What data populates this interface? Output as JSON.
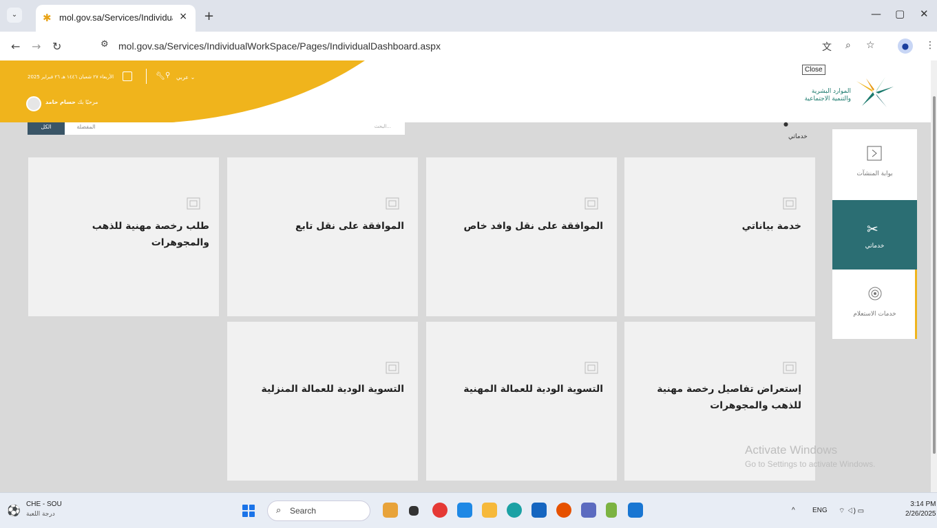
{
  "browser": {
    "tab_title": "mol.gov.sa/Services/IndividualW",
    "tab_close": "×",
    "new_tab": "+",
    "url": "mol.gov.sa/Services/IndividualWorkSpace/Pages/IndividualDashboard.aspx",
    "window_controls": {
      "minimize": "—",
      "maximize": "▢",
      "close": "✕"
    }
  },
  "header": {
    "date_text": "الأربعاء ٢٧ شعبان ١٤٤٦ هـ ٢٦ فبراير 2025",
    "language": "عربي ⌄",
    "welcome_prefix": "مرحبًا بك",
    "user_name": "حسام حامد",
    "logo_line1": "الموارد البشرية",
    "logo_line2": "والتنمية الاجتماعية",
    "close_tooltip": "Close"
  },
  "toolbar": {
    "search_placeholder": "البحث...",
    "favorites_label": "المفضلة",
    "all_label": "الكل"
  },
  "breadcrumb": "خدماتي",
  "cards": [
    {
      "title": "خدمة بياناتي"
    },
    {
      "title": "الموافقة على نقل وافد خاص"
    },
    {
      "title": "الموافقة على نقل تابع"
    },
    {
      "title": "طلب رخصة مهنية للذهب والمجوهرات"
    },
    {
      "title": "إستعراض تفاصيل رخصة مهنية للذهب والمجوهرات"
    },
    {
      "title": "التسوية الودية للعمالة المهنية"
    },
    {
      "title": "التسوية الودية للعمالة المنزلية"
    }
  ],
  "side_menu": [
    {
      "label": "بوابة المنشآت",
      "icon": "portal-icon"
    },
    {
      "label": "خدماتي",
      "icon": "tools-icon",
      "active": true
    },
    {
      "label": "خدمات الاستعلام",
      "icon": "inquiry-icon"
    }
  ],
  "watermark": {
    "line1": "Activate Windows",
    "line2": "Go to Settings to activate Windows."
  },
  "taskbar": {
    "weather_line1": "CHE - SOU",
    "weather_line2": "درجة اللعبة",
    "search_label": "Search",
    "language": "ENG",
    "time": "3:14 PM",
    "date": "2/26/2025"
  },
  "colors": {
    "brand_yellow": "#f0b41c",
    "brand_teal": "#2b6e73",
    "brand_green": "#1b7a6d"
  }
}
